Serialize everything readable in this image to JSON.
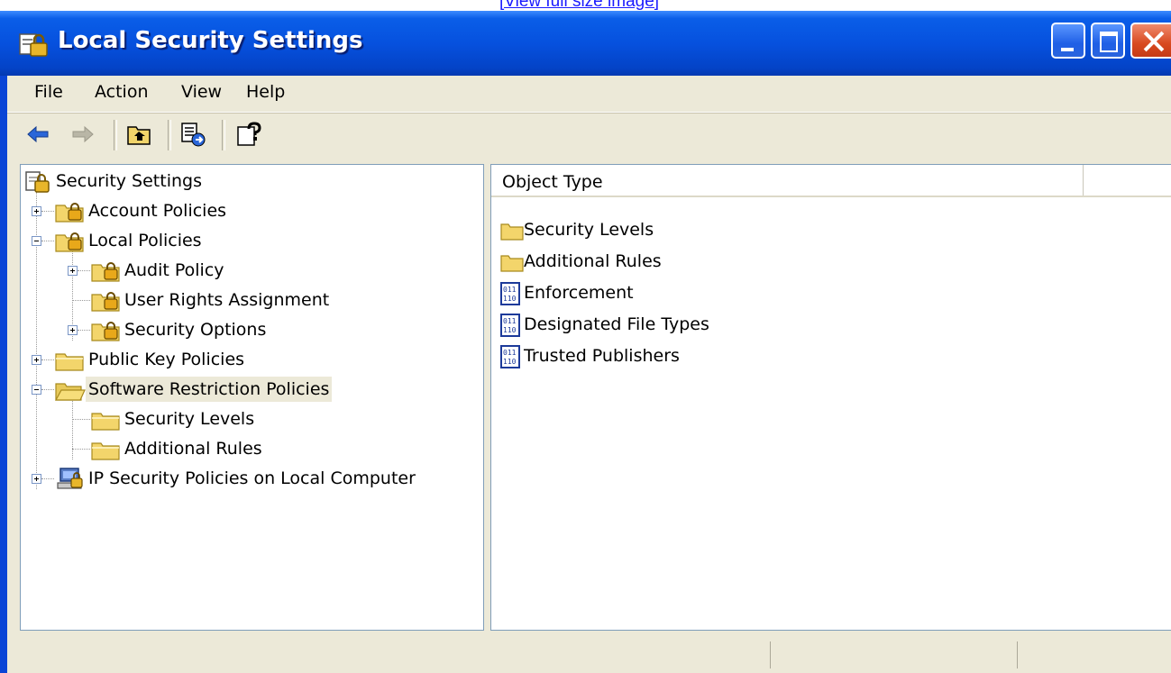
{
  "top_link": "[View full size image]",
  "window": {
    "title": "Local Security Settings"
  },
  "menu": [
    {
      "label": "File"
    },
    {
      "label": "Action"
    },
    {
      "label": "View"
    },
    {
      "label": "Help"
    }
  ],
  "toolbar": {
    "back": "back-arrow-icon",
    "forward": "forward-arrow-icon",
    "up": "up-one-level-icon",
    "export": "export-list-icon",
    "help": "help-icon"
  },
  "tree": {
    "root": "Security Settings",
    "items": [
      {
        "label": "Account Policies",
        "icon": "secured-folder-icon",
        "expander": "plus"
      },
      {
        "label": "Local Policies",
        "icon": "secured-folder-icon",
        "expander": "minus"
      },
      {
        "label": "Audit Policy",
        "icon": "secured-folder-icon",
        "expander": "plus"
      },
      {
        "label": "User Rights Assignment",
        "icon": "secured-folder-icon",
        "expander": "none"
      },
      {
        "label": "Security Options",
        "icon": "secured-folder-icon",
        "expander": "plus"
      },
      {
        "label": "Public Key Policies",
        "icon": "folder-icon",
        "expander": "plus"
      },
      {
        "label": "Software Restriction Policies",
        "icon": "open-folder-icon",
        "expander": "minus",
        "selected": true
      },
      {
        "label": "Security Levels",
        "icon": "folder-icon",
        "expander": "none"
      },
      {
        "label": "Additional Rules",
        "icon": "folder-icon",
        "expander": "none"
      },
      {
        "label": "IP Security Policies on Local Computer",
        "icon": "ip-security-icon",
        "expander": "plus"
      }
    ]
  },
  "list": {
    "column_header": "Object Type",
    "items": [
      {
        "label": "Security Levels",
        "icon": "folder-icon"
      },
      {
        "label": "Additional Rules",
        "icon": "folder-icon"
      },
      {
        "label": "Enforcement",
        "icon": "policy-setting-icon"
      },
      {
        "label": "Designated File Types",
        "icon": "policy-setting-icon"
      },
      {
        "label": "Trusted Publishers",
        "icon": "policy-setting-icon"
      }
    ]
  },
  "colors": {
    "titlebar": "#0651de",
    "face": "#ece9d8",
    "close_button": "#d8491f"
  }
}
